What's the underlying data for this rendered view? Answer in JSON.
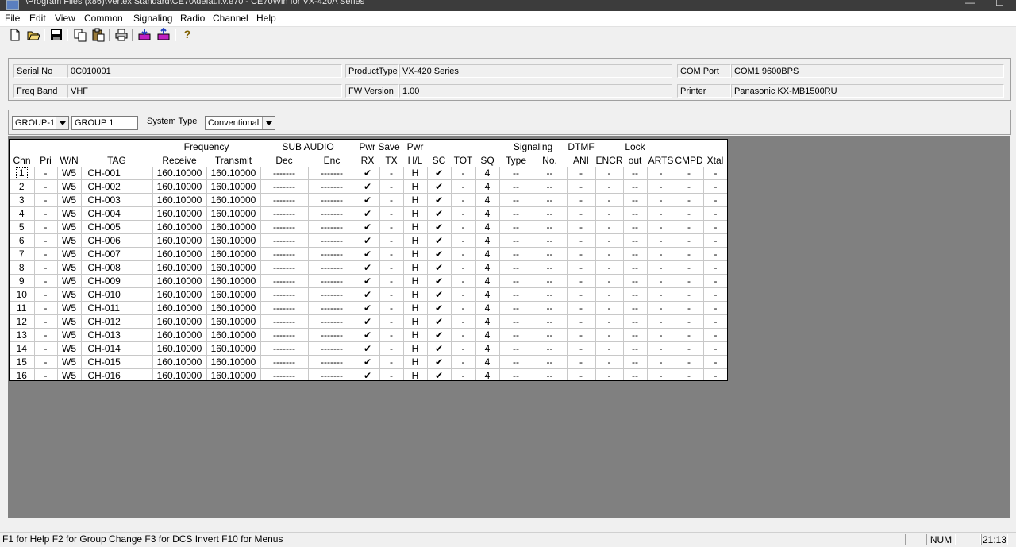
{
  "window": {
    "title": "\\Program Files (x86)\\Vertex Standard\\CE70\\defaultv.e70 - CE70Win for VX-420A Series",
    "minimize_glyph": "—",
    "maximize_glyph": "☐"
  },
  "menu": [
    "File",
    "Edit",
    "View",
    "Common",
    "Signaling",
    "Radio",
    "Channel",
    "Help"
  ],
  "toolbar": {
    "icons": [
      "new-file-icon",
      "open-folder-icon",
      "save-icon",
      "copy-icon",
      "paste-icon",
      "print-icon",
      "read-radio-icon",
      "write-radio-icon",
      "help-icon"
    ],
    "help_glyph": "?"
  },
  "info": {
    "serial_no_label": "Serial No",
    "serial_no_value": "0C010001",
    "freq_band_label": "Freq Band",
    "freq_band_value": "VHF",
    "product_type_label": "ProductType",
    "product_type_value": "VX-420 Series",
    "fw_version_label": "FW Version",
    "fw_version_value": "1.00",
    "com_port_label": "COM Port",
    "com_port_value": "COM1  9600BPS",
    "printer_label": "Printer",
    "printer_value": "Panasonic KX-MB1500RU"
  },
  "group": {
    "group_select": "GROUP-1",
    "group_name": "GROUP 1",
    "system_type_label": "System Type",
    "system_type_value": "Conventional"
  },
  "grid": {
    "group_headers": {
      "frequency": "Frequency",
      "sub_audio": "SUB AUDIO",
      "pwr_save": "Pwr Save",
      "pwr": "Pwr",
      "signaling": "Signaling",
      "dtmf": "DTMF",
      "lock": "Lock"
    },
    "columns": [
      "Chn",
      "Pri",
      "W/N",
      "TAG",
      "Receive",
      "Transmit",
      "Dec",
      "Enc",
      "RX",
      "TX",
      "H/L",
      "SC",
      "TOT",
      "SQ",
      "Type",
      "No.",
      "ANI",
      "ENCR",
      "out",
      "ARTS",
      "CMPD",
      "Xtal"
    ],
    "rows": [
      [
        "1",
        "-",
        "W5",
        "CH-001",
        "160.10000",
        "160.10000",
        "-------",
        "-------",
        "✔",
        "-",
        "H",
        "✔",
        "-",
        "4",
        "--",
        "--",
        "-",
        "-",
        "--",
        "-",
        "-",
        "-"
      ],
      [
        "2",
        "-",
        "W5",
        "CH-002",
        "160.10000",
        "160.10000",
        "-------",
        "-------",
        "✔",
        "-",
        "H",
        "✔",
        "-",
        "4",
        "--",
        "--",
        "-",
        "-",
        "--",
        "-",
        "-",
        "-"
      ],
      [
        "3",
        "-",
        "W5",
        "CH-003",
        "160.10000",
        "160.10000",
        "-------",
        "-------",
        "✔",
        "-",
        "H",
        "✔",
        "-",
        "4",
        "--",
        "--",
        "-",
        "-",
        "--",
        "-",
        "-",
        "-"
      ],
      [
        "4",
        "-",
        "W5",
        "CH-004",
        "160.10000",
        "160.10000",
        "-------",
        "-------",
        "✔",
        "-",
        "H",
        "✔",
        "-",
        "4",
        "--",
        "--",
        "-",
        "-",
        "--",
        "-",
        "-",
        "-"
      ],
      [
        "5",
        "-",
        "W5",
        "CH-005",
        "160.10000",
        "160.10000",
        "-------",
        "-------",
        "✔",
        "-",
        "H",
        "✔",
        "-",
        "4",
        "--",
        "--",
        "-",
        "-",
        "--",
        "-",
        "-",
        "-"
      ],
      [
        "6",
        "-",
        "W5",
        "CH-006",
        "160.10000",
        "160.10000",
        "-------",
        "-------",
        "✔",
        "-",
        "H",
        "✔",
        "-",
        "4",
        "--",
        "--",
        "-",
        "-",
        "--",
        "-",
        "-",
        "-"
      ],
      [
        "7",
        "-",
        "W5",
        "CH-007",
        "160.10000",
        "160.10000",
        "-------",
        "-------",
        "✔",
        "-",
        "H",
        "✔",
        "-",
        "4",
        "--",
        "--",
        "-",
        "-",
        "--",
        "-",
        "-",
        "-"
      ],
      [
        "8",
        "-",
        "W5",
        "CH-008",
        "160.10000",
        "160.10000",
        "-------",
        "-------",
        "✔",
        "-",
        "H",
        "✔",
        "-",
        "4",
        "--",
        "--",
        "-",
        "-",
        "--",
        "-",
        "-",
        "-"
      ],
      [
        "9",
        "-",
        "W5",
        "CH-009",
        "160.10000",
        "160.10000",
        "-------",
        "-------",
        "✔",
        "-",
        "H",
        "✔",
        "-",
        "4",
        "--",
        "--",
        "-",
        "-",
        "--",
        "-",
        "-",
        "-"
      ],
      [
        "10",
        "-",
        "W5",
        "CH-010",
        "160.10000",
        "160.10000",
        "-------",
        "-------",
        "✔",
        "-",
        "H",
        "✔",
        "-",
        "4",
        "--",
        "--",
        "-",
        "-",
        "--",
        "-",
        "-",
        "-"
      ],
      [
        "11",
        "-",
        "W5",
        "CH-011",
        "160.10000",
        "160.10000",
        "-------",
        "-------",
        "✔",
        "-",
        "H",
        "✔",
        "-",
        "4",
        "--",
        "--",
        "-",
        "-",
        "--",
        "-",
        "-",
        "-"
      ],
      [
        "12",
        "-",
        "W5",
        "CH-012",
        "160.10000",
        "160.10000",
        "-------",
        "-------",
        "✔",
        "-",
        "H",
        "✔",
        "-",
        "4",
        "--",
        "--",
        "-",
        "-",
        "--",
        "-",
        "-",
        "-"
      ],
      [
        "13",
        "-",
        "W5",
        "CH-013",
        "160.10000",
        "160.10000",
        "-------",
        "-------",
        "✔",
        "-",
        "H",
        "✔",
        "-",
        "4",
        "--",
        "--",
        "-",
        "-",
        "--",
        "-",
        "-",
        "-"
      ],
      [
        "14",
        "-",
        "W5",
        "CH-014",
        "160.10000",
        "160.10000",
        "-------",
        "-------",
        "✔",
        "-",
        "H",
        "✔",
        "-",
        "4",
        "--",
        "--",
        "-",
        "-",
        "--",
        "-",
        "-",
        "-"
      ],
      [
        "15",
        "-",
        "W5",
        "CH-015",
        "160.10000",
        "160.10000",
        "-------",
        "-------",
        "✔",
        "-",
        "H",
        "✔",
        "-",
        "4",
        "--",
        "--",
        "-",
        "-",
        "--",
        "-",
        "-",
        "-"
      ],
      [
        "16",
        "-",
        "W5",
        "CH-016",
        "160.10000",
        "160.10000",
        "-------",
        "-------",
        "✔",
        "-",
        "H",
        "✔",
        "-",
        "4",
        "--",
        "--",
        "-",
        "-",
        "--",
        "-",
        "-",
        "-"
      ]
    ]
  },
  "status": {
    "help_text": "F1 for Help  F2 for Group Change  F3 for DCS Invert  F10 for Menus",
    "num": "NUM",
    "time": "21:13"
  },
  "colors": {
    "grid_bg": "#808080",
    "titlebar": "#3c3c3c"
  }
}
